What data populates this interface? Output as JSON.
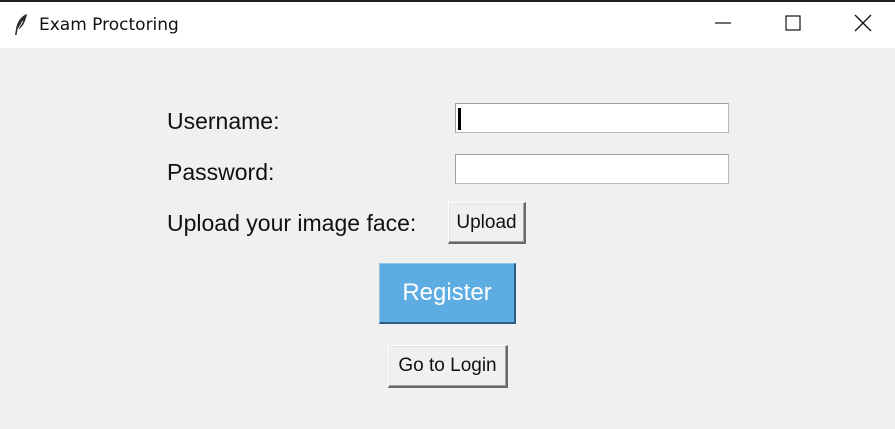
{
  "window": {
    "title": "Exam Proctoring",
    "icon": "feather-icon",
    "controls": [
      "minimize-icon",
      "maximize-icon",
      "close-icon"
    ]
  },
  "form": {
    "username_label": "Username:",
    "username_value": "",
    "password_label": "Password:",
    "password_value": "",
    "upload_label": "Upload your image face:",
    "upload_button": "Upload",
    "register_button": "Register",
    "login_button": "Go to Login"
  },
  "colors": {
    "register_bg": "#5dade2",
    "register_text": "#ffffff",
    "window_bg": "#f0f0f0"
  }
}
